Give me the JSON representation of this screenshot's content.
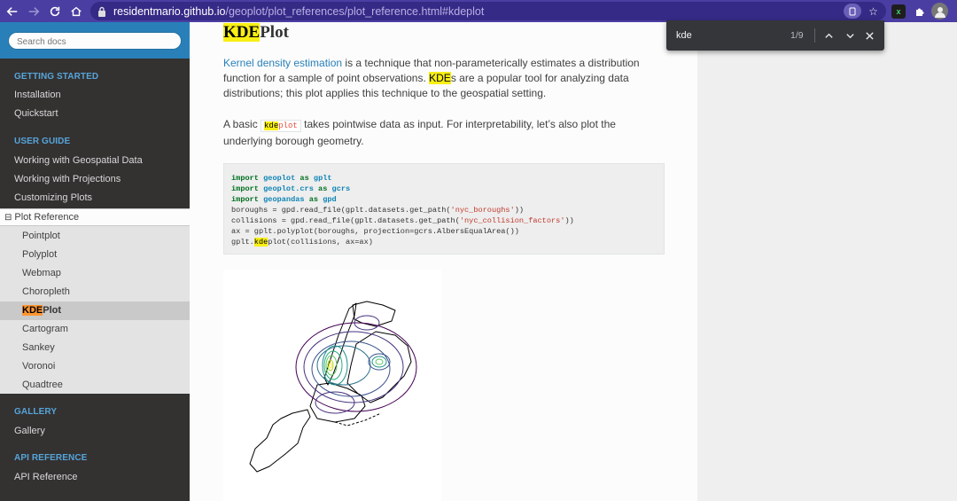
{
  "browser": {
    "url_host": "residentmario.github.io",
    "url_path": "/geoplot/plot_references/plot_reference.html#kdeplot"
  },
  "find": {
    "query": "kde",
    "count": "1/9"
  },
  "sidebar": {
    "search_placeholder": "Search docs",
    "sections": [
      {
        "title": "GETTING STARTED",
        "items": [
          "Installation",
          "Quickstart"
        ]
      },
      {
        "title": "USER GUIDE",
        "items": [
          "Working with Geospatial Data",
          "Working with Projections",
          "Customizing Plots"
        ]
      }
    ],
    "current": {
      "toggle": "⊟",
      "label": "Plot Reference",
      "items": [
        "Pointplot",
        "Polyplot",
        "Webmap",
        "Choropleth",
        "KDEPlot",
        "Cartogram",
        "Sankey",
        "Voronoi",
        "Quadtree"
      ],
      "active_highlight": "KDE",
      "active_rest": "Plot"
    },
    "gallery": {
      "title": "GALLERY",
      "item": "Gallery"
    },
    "api": {
      "title": "API REFERENCE",
      "item": "API Reference"
    }
  },
  "main": {
    "title_highlight": "KDE",
    "title_rest": "Plot",
    "p1": {
      "link": "Kernel density estimation",
      "t1": " is a technique that non-parameterically estimates a distribution function for a sample of point observations. ",
      "hl": "KDE",
      "t2": "s are a popular tool for analyzing data distributions; this plot applies this technique to the geospatial setting."
    },
    "p2": {
      "t1": "A basic ",
      "code_hl": "kde",
      "code_rest": "plot",
      "t2": " takes pointwise data as input. For interpretability, let’s also plot the underlying borough geometry."
    },
    "code": {
      "l1": {
        "kw1": "import",
        "mod": "geoplot",
        "kw2": "as",
        "alias": "gplt"
      },
      "l2": {
        "kw1": "import",
        "mod": "geoplot.crs",
        "kw2": "as",
        "alias": "gcrs"
      },
      "l3": {
        "kw1": "import",
        "mod": "geopandas",
        "kw2": "as",
        "alias": "gpd"
      },
      "l4": {
        "pre": "boroughs = gpd.read_file(gplt.datasets.get_path(",
        "str": "'nyc_boroughs'",
        "post": "))"
      },
      "l5": {
        "pre": "collisions = gpd.read_file(gplt.datasets.get_path(",
        "str": "'nyc_collision_factors'",
        "post": "))"
      },
      "l6": "ax = gplt.polyplot(boroughs, projection=gcrs.AlbersEqualArea())",
      "l7": {
        "pre": "gplt.",
        "hl": "kde",
        "post": "plot(collisions, ax=ax)"
      }
    }
  },
  "colors": {
    "browser_bar": "#4b3ea2",
    "sidebar_bg": "#343131",
    "sidebar_accent": "#2980b9",
    "find_highlight": "#f8ef14",
    "find_active": "#ff9632",
    "contour_colors": [
      "#440154",
      "#3b528b",
      "#21918c",
      "#5ec962",
      "#fde725"
    ]
  }
}
